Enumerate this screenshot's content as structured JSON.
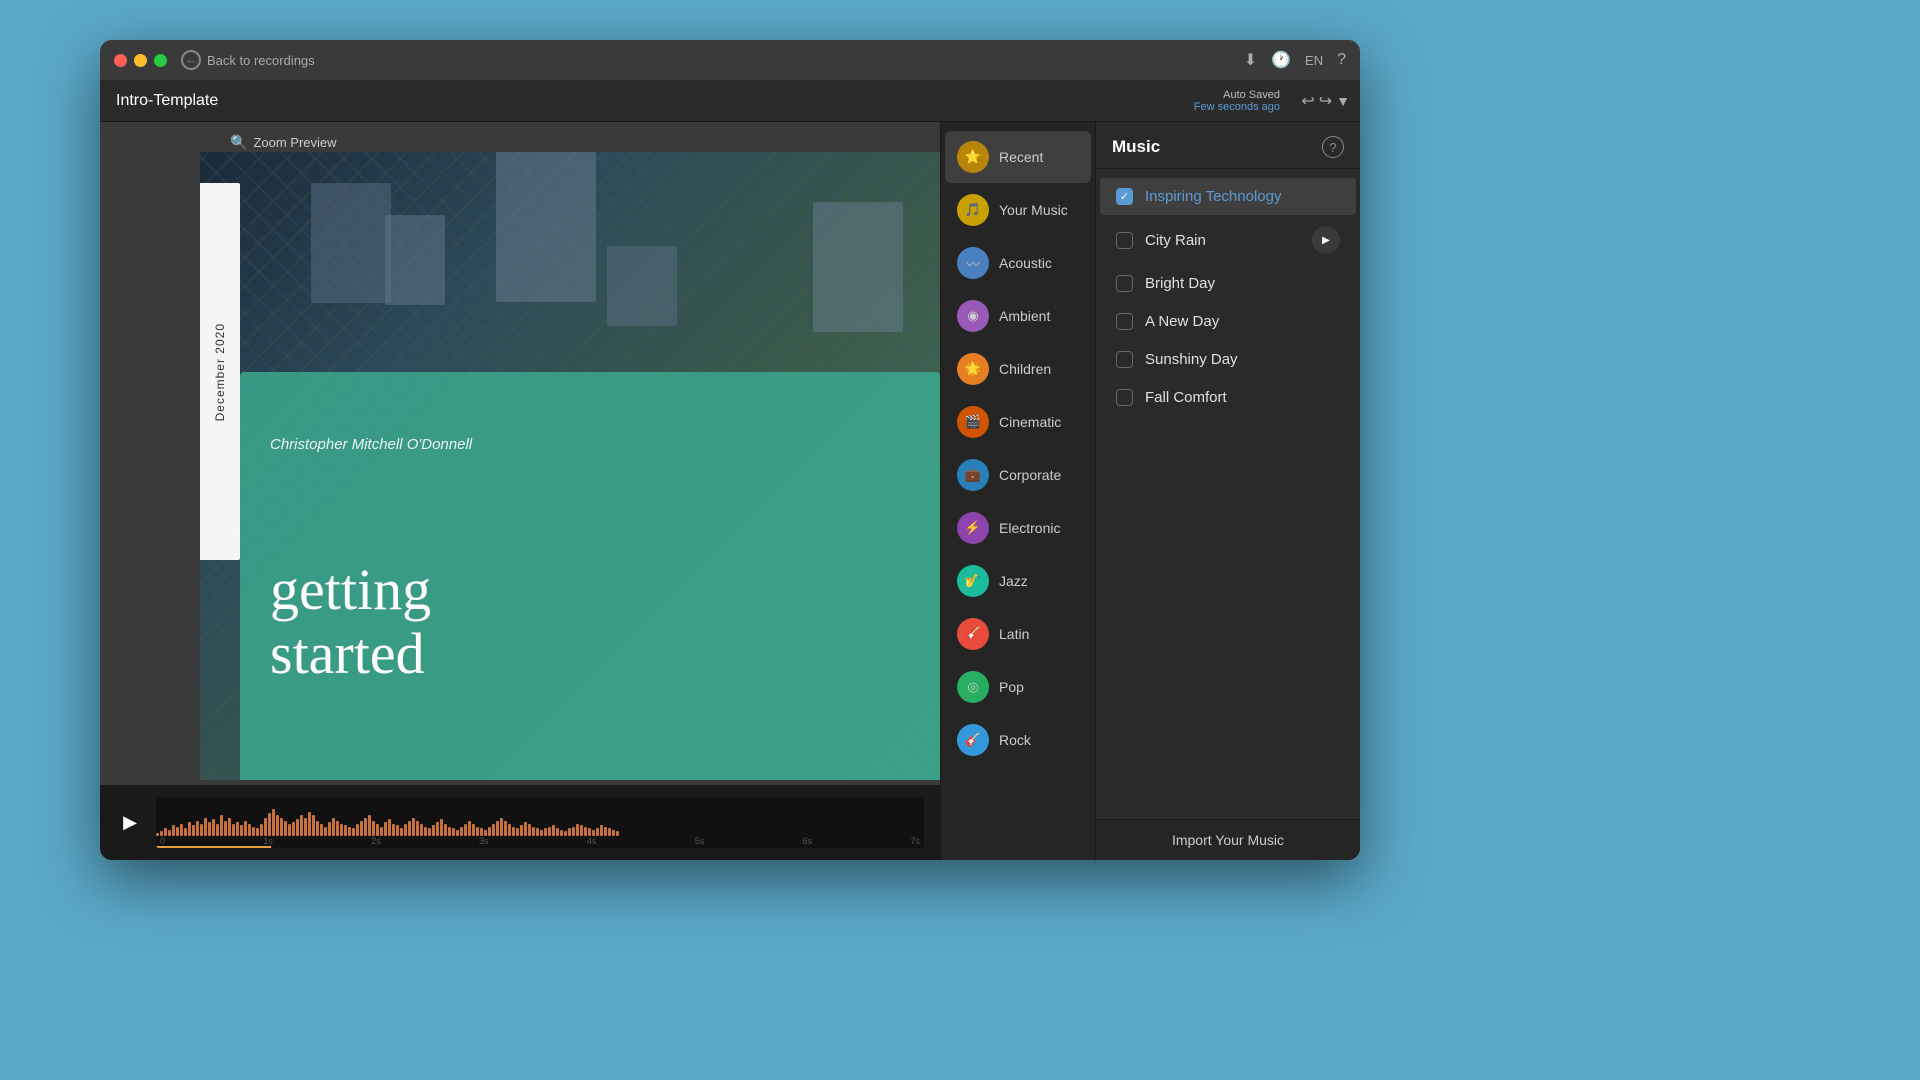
{
  "window": {
    "title": "Intro-Template"
  },
  "titlebar": {
    "back_label": "Back to recordings",
    "lang": "EN",
    "auto_saved_label": "Auto Saved",
    "auto_saved_time": "Few seconds ago"
  },
  "preview": {
    "zoom_label": "Zoom Preview",
    "slide": {
      "date": "December 2020",
      "author": "Christopher Mitchell O'Donnell",
      "title_line1": "getting",
      "title_line2": "started"
    }
  },
  "timeline": {
    "markers": [
      "0",
      "1s",
      "2s",
      "3s",
      "4s",
      "5s",
      "6s",
      "7s"
    ]
  },
  "music_panel": {
    "title": "Music",
    "help_label": "?",
    "import_label": "Import Your Music",
    "categories": [
      {
        "id": "recent",
        "label": "Recent",
        "icon": "⭐",
        "color": "#b8860b",
        "active": true
      },
      {
        "id": "your-music",
        "label": "Your Music",
        "icon": "🎵",
        "color": "#c8a000"
      },
      {
        "id": "acoustic",
        "label": "Acoustic",
        "icon": "🌊",
        "color": "#4a80c0"
      },
      {
        "id": "ambient",
        "label": "Ambient",
        "icon": "💜",
        "color": "#9b59b6"
      },
      {
        "id": "children",
        "label": "Children",
        "icon": "🧡",
        "color": "#e67e22"
      },
      {
        "id": "cinematic",
        "label": "Cinematic",
        "icon": "🟠",
        "color": "#d35400"
      },
      {
        "id": "corporate",
        "label": "Corporate",
        "icon": "🔵",
        "color": "#2980b9"
      },
      {
        "id": "electronic",
        "label": "Electronic",
        "icon": "💜",
        "color": "#8e44ad"
      },
      {
        "id": "jazz",
        "label": "Jazz",
        "icon": "🌀",
        "color": "#1abc9c"
      },
      {
        "id": "latin",
        "label": "Latin",
        "icon": "🔴",
        "color": "#e74c3c"
      },
      {
        "id": "pop",
        "label": "Pop",
        "icon": "🟢",
        "color": "#27ae60"
      },
      {
        "id": "rock",
        "label": "Rock",
        "icon": "💙",
        "color": "#2980b9"
      }
    ],
    "tracks": [
      {
        "id": "inspiring-technology",
        "label": "Inspiring Technology",
        "checked": true,
        "selected": true,
        "showPlay": false
      },
      {
        "id": "city-rain",
        "label": "City Rain",
        "checked": false,
        "selected": false,
        "showPlay": true
      },
      {
        "id": "bright-day",
        "label": "Bright Day",
        "checked": false,
        "selected": false,
        "showPlay": false
      },
      {
        "id": "a-new-day",
        "label": "A New Day",
        "checked": false,
        "selected": false,
        "showPlay": false
      },
      {
        "id": "sunshiny-day",
        "label": "Sunshiny Day",
        "checked": false,
        "selected": false,
        "showPlay": false
      },
      {
        "id": "fall-comfort",
        "label": "Fall Comfort",
        "checked": false,
        "selected": false,
        "showPlay": false
      }
    ]
  }
}
